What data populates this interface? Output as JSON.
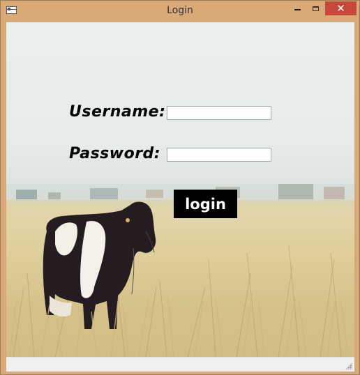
{
  "window": {
    "title": "Login",
    "close_glyph": "✕",
    "icons": [
      "app-window-icon",
      "minimize-icon",
      "maximize-icon",
      "close-icon"
    ],
    "colors": {
      "frame": "#d9a978",
      "close_button": "#c7473a",
      "statusbar": "#f0f0f0"
    }
  },
  "form": {
    "username_label": "Username:",
    "password_label": "Password:",
    "username_value": "",
    "password_value": "",
    "login_button_label": "login",
    "colors": {
      "label_text": "#000000",
      "button_background": "#000000",
      "button_text": "#ffffff"
    }
  },
  "background": {
    "subject": "cow standing in dry grass field"
  }
}
